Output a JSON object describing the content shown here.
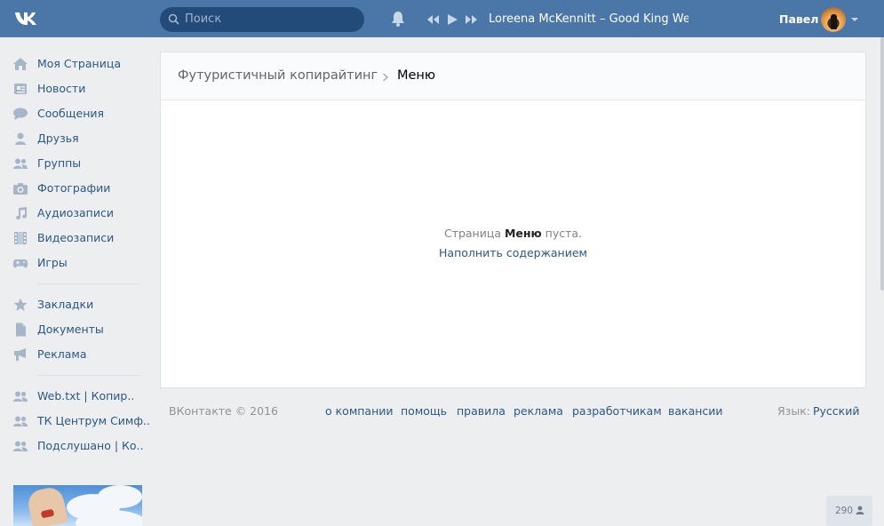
{
  "header": {
    "logo": "vk-logo",
    "search_placeholder": "Поиск",
    "player": {
      "track": "Loreena McKennitt – Good King Wenc..."
    },
    "user_name": "Павел"
  },
  "sidebar": {
    "items": [
      {
        "label": "Моя Страница",
        "icon": "home-icon"
      },
      {
        "label": "Новости",
        "icon": "news-icon"
      },
      {
        "label": "Сообщения",
        "icon": "messages-icon"
      },
      {
        "label": "Друзья",
        "icon": "friend-icon"
      },
      {
        "label": "Группы",
        "icon": "groups-icon"
      },
      {
        "label": "Фотографии",
        "icon": "camera-icon"
      },
      {
        "label": "Аудиозаписи",
        "icon": "music-note-icon"
      },
      {
        "label": "Видеозаписи",
        "icon": "film-icon"
      },
      {
        "label": "Игры",
        "icon": "gamepad-icon"
      }
    ],
    "items2": [
      {
        "label": "Закладки",
        "icon": "star-icon"
      },
      {
        "label": "Документы",
        "icon": "document-icon"
      },
      {
        "label": "Реклама",
        "icon": "megaphone-icon"
      }
    ],
    "groups": [
      {
        "label": "Web.txt | Копир.."
      },
      {
        "label": "ТК Центрум Симф.."
      },
      {
        "label": "Подслушано | Ко.."
      }
    ]
  },
  "main": {
    "breadcrumb_parent": "Футуристичный копирайтинг",
    "breadcrumb_current": "Меню",
    "empty_prefix": "Страница ",
    "empty_name": "Меню",
    "empty_suffix": " пуста.",
    "fill_link": "Наполнить содержанием"
  },
  "footer": {
    "copyright": "ВКонтакте © 2016",
    "links": [
      "о компании",
      "помощь",
      "правила",
      "реклама",
      "разработчикам",
      "вакансии"
    ],
    "language_label": "Язык:",
    "language_value": "Русский"
  },
  "counter": "290",
  "colors": {
    "header": "#4a76a8",
    "link": "#2a5885",
    "background": "#edeef0"
  }
}
